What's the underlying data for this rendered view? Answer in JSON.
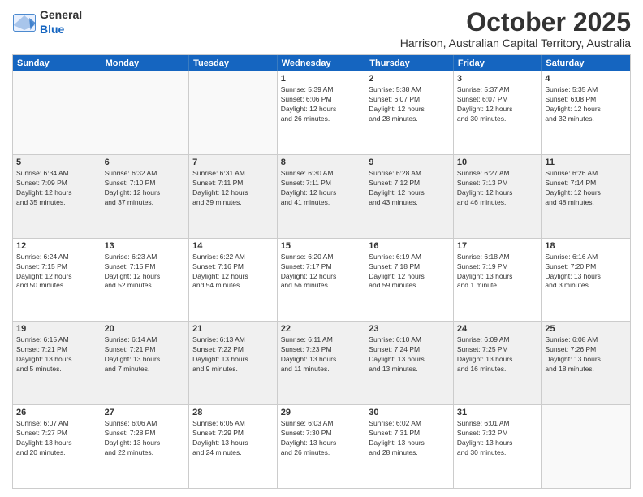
{
  "header": {
    "logo": {
      "general": "General",
      "blue": "Blue"
    },
    "month": "October 2025",
    "location": "Harrison, Australian Capital Territory, Australia"
  },
  "weekdays": [
    "Sunday",
    "Monday",
    "Tuesday",
    "Wednesday",
    "Thursday",
    "Friday",
    "Saturday"
  ],
  "rows": [
    [
      {
        "day": "",
        "info": ""
      },
      {
        "day": "",
        "info": ""
      },
      {
        "day": "",
        "info": ""
      },
      {
        "day": "1",
        "info": "Sunrise: 5:39 AM\nSunset: 6:06 PM\nDaylight: 12 hours\nand 26 minutes."
      },
      {
        "day": "2",
        "info": "Sunrise: 5:38 AM\nSunset: 6:07 PM\nDaylight: 12 hours\nand 28 minutes."
      },
      {
        "day": "3",
        "info": "Sunrise: 5:37 AM\nSunset: 6:07 PM\nDaylight: 12 hours\nand 30 minutes."
      },
      {
        "day": "4",
        "info": "Sunrise: 5:35 AM\nSunset: 6:08 PM\nDaylight: 12 hours\nand 32 minutes."
      }
    ],
    [
      {
        "day": "5",
        "info": "Sunrise: 6:34 AM\nSunset: 7:09 PM\nDaylight: 12 hours\nand 35 minutes."
      },
      {
        "day": "6",
        "info": "Sunrise: 6:32 AM\nSunset: 7:10 PM\nDaylight: 12 hours\nand 37 minutes."
      },
      {
        "day": "7",
        "info": "Sunrise: 6:31 AM\nSunset: 7:11 PM\nDaylight: 12 hours\nand 39 minutes."
      },
      {
        "day": "8",
        "info": "Sunrise: 6:30 AM\nSunset: 7:11 PM\nDaylight: 12 hours\nand 41 minutes."
      },
      {
        "day": "9",
        "info": "Sunrise: 6:28 AM\nSunset: 7:12 PM\nDaylight: 12 hours\nand 43 minutes."
      },
      {
        "day": "10",
        "info": "Sunrise: 6:27 AM\nSunset: 7:13 PM\nDaylight: 12 hours\nand 46 minutes."
      },
      {
        "day": "11",
        "info": "Sunrise: 6:26 AM\nSunset: 7:14 PM\nDaylight: 12 hours\nand 48 minutes."
      }
    ],
    [
      {
        "day": "12",
        "info": "Sunrise: 6:24 AM\nSunset: 7:15 PM\nDaylight: 12 hours\nand 50 minutes."
      },
      {
        "day": "13",
        "info": "Sunrise: 6:23 AM\nSunset: 7:15 PM\nDaylight: 12 hours\nand 52 minutes."
      },
      {
        "day": "14",
        "info": "Sunrise: 6:22 AM\nSunset: 7:16 PM\nDaylight: 12 hours\nand 54 minutes."
      },
      {
        "day": "15",
        "info": "Sunrise: 6:20 AM\nSunset: 7:17 PM\nDaylight: 12 hours\nand 56 minutes."
      },
      {
        "day": "16",
        "info": "Sunrise: 6:19 AM\nSunset: 7:18 PM\nDaylight: 12 hours\nand 59 minutes."
      },
      {
        "day": "17",
        "info": "Sunrise: 6:18 AM\nSunset: 7:19 PM\nDaylight: 13 hours\nand 1 minute."
      },
      {
        "day": "18",
        "info": "Sunrise: 6:16 AM\nSunset: 7:20 PM\nDaylight: 13 hours\nand 3 minutes."
      }
    ],
    [
      {
        "day": "19",
        "info": "Sunrise: 6:15 AM\nSunset: 7:21 PM\nDaylight: 13 hours\nand 5 minutes."
      },
      {
        "day": "20",
        "info": "Sunrise: 6:14 AM\nSunset: 7:21 PM\nDaylight: 13 hours\nand 7 minutes."
      },
      {
        "day": "21",
        "info": "Sunrise: 6:13 AM\nSunset: 7:22 PM\nDaylight: 13 hours\nand 9 minutes."
      },
      {
        "day": "22",
        "info": "Sunrise: 6:11 AM\nSunset: 7:23 PM\nDaylight: 13 hours\nand 11 minutes."
      },
      {
        "day": "23",
        "info": "Sunrise: 6:10 AM\nSunset: 7:24 PM\nDaylight: 13 hours\nand 13 minutes."
      },
      {
        "day": "24",
        "info": "Sunrise: 6:09 AM\nSunset: 7:25 PM\nDaylight: 13 hours\nand 16 minutes."
      },
      {
        "day": "25",
        "info": "Sunrise: 6:08 AM\nSunset: 7:26 PM\nDaylight: 13 hours\nand 18 minutes."
      }
    ],
    [
      {
        "day": "26",
        "info": "Sunrise: 6:07 AM\nSunset: 7:27 PM\nDaylight: 13 hours\nand 20 minutes."
      },
      {
        "day": "27",
        "info": "Sunrise: 6:06 AM\nSunset: 7:28 PM\nDaylight: 13 hours\nand 22 minutes."
      },
      {
        "day": "28",
        "info": "Sunrise: 6:05 AM\nSunset: 7:29 PM\nDaylight: 13 hours\nand 24 minutes."
      },
      {
        "day": "29",
        "info": "Sunrise: 6:03 AM\nSunset: 7:30 PM\nDaylight: 13 hours\nand 26 minutes."
      },
      {
        "day": "30",
        "info": "Sunrise: 6:02 AM\nSunset: 7:31 PM\nDaylight: 13 hours\nand 28 minutes."
      },
      {
        "day": "31",
        "info": "Sunrise: 6:01 AM\nSunset: 7:32 PM\nDaylight: 13 hours\nand 30 minutes."
      },
      {
        "day": "",
        "info": ""
      }
    ]
  ]
}
